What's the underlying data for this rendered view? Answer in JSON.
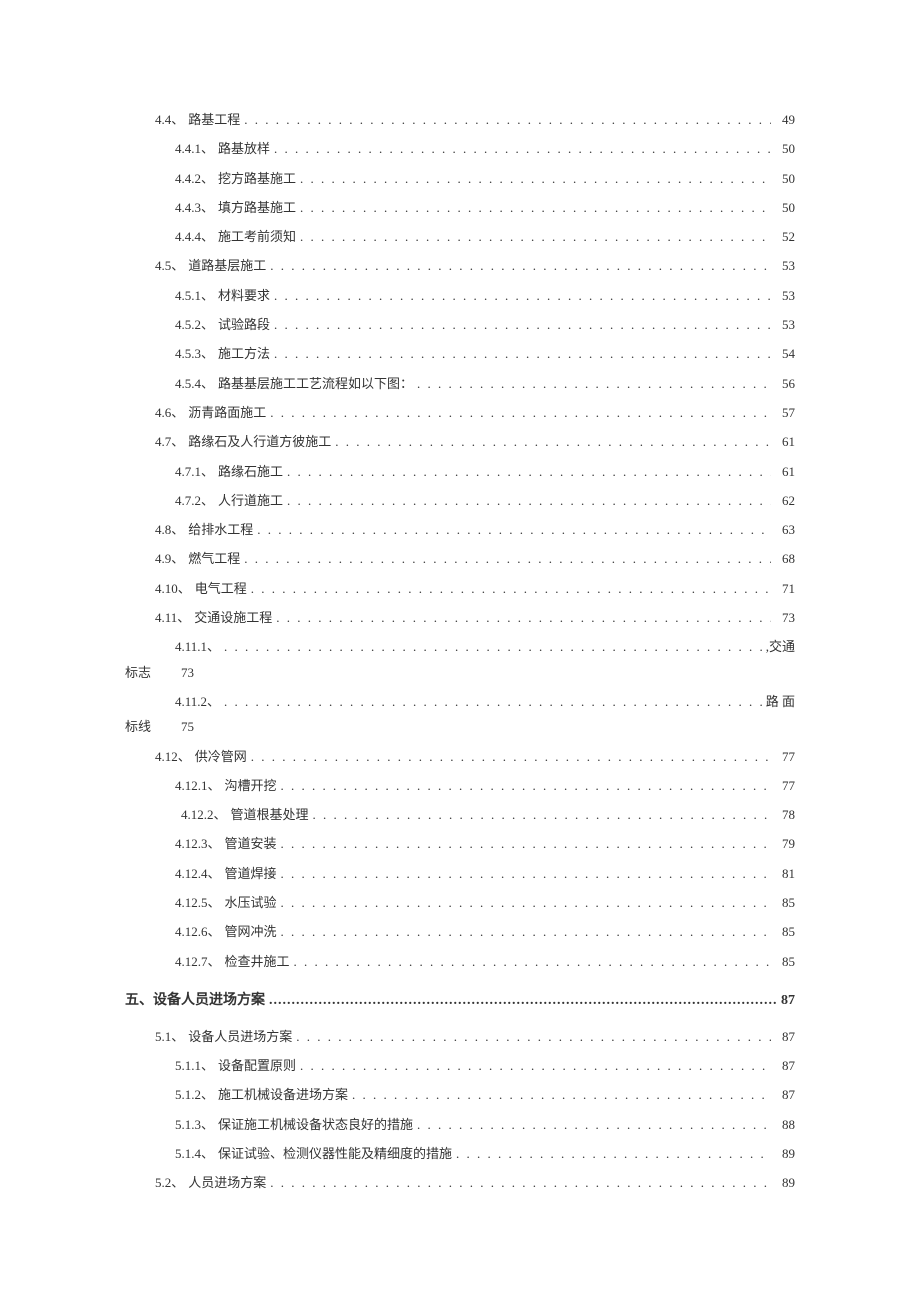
{
  "entries": [
    {
      "lvl": 0,
      "num": "4.4、",
      "title": "路基工程",
      "page": "49"
    },
    {
      "lvl": 1,
      "num": "4.4.1、",
      "title": "路基放样",
      "page": "50"
    },
    {
      "lvl": 1,
      "num": "4.4.2、",
      "title": "挖方路基施工",
      "page": "50"
    },
    {
      "lvl": 1,
      "num": "4.4.3、",
      "title": "填方路基施工",
      "page": "50"
    },
    {
      "lvl": 1,
      "num": "4.4.4、",
      "title": "施工考前须知",
      "page": "52"
    },
    {
      "lvl": 0,
      "num": "4.5、",
      "title": "道路基层施工",
      "page": "53"
    },
    {
      "lvl": 1,
      "num": "4.5.1、",
      "title": "材料要求",
      "page": "53"
    },
    {
      "lvl": 1,
      "num": "4.5.2、",
      "title": "试验路段",
      "page": "53"
    },
    {
      "lvl": 1,
      "num": "4.5.3、",
      "title": "施工方法",
      "page": "54"
    },
    {
      "lvl": 1,
      "num": "4.5.4、",
      "title": "路基基层施工工艺流程如以下图：",
      "page": "56"
    },
    {
      "lvl": 0,
      "num": "4.6、",
      "title": "沥青路面施工 ",
      "page": "57"
    },
    {
      "lvl": 0,
      "num": "4.7、",
      "title": "路缘石及人行道方彼施工",
      "page": "61"
    },
    {
      "lvl": 1,
      "num": "4.7.1、",
      "title": "路缘石施工",
      "page": "61"
    },
    {
      "lvl": 1,
      "num": "4.7.2、",
      "title": "人行道施工",
      "page": "62"
    },
    {
      "lvl": 0,
      "num": "4.8、",
      "title": "给排水工程",
      "page": "63"
    },
    {
      "lvl": 0,
      "num": "4.9、",
      "title": "燃气工程",
      "page": "68"
    },
    {
      "lvl": 0,
      "num": "4.10、",
      "title": "电气工程 ",
      "page": "71"
    },
    {
      "lvl": 0,
      "num": "4.11、",
      "title": "交通设施工程 ",
      "page": "73"
    },
    {
      "lvl": 1,
      "num": "4.11.1、",
      "title": "",
      "trailing": ",交通",
      "wrapTitle": "标志",
      "wrapPage": "73"
    },
    {
      "lvl": 1,
      "num": "4.11.2、",
      "title": "",
      "trailing": "路 面",
      "wrapTitle": "标线",
      "wrapPage": "75"
    },
    {
      "lvl": 0,
      "num": "4.12、",
      "title": "供冷管网 ",
      "page": "77"
    },
    {
      "lvl": 1,
      "num": "4.12.1、",
      "title": "沟槽开挖",
      "page": "77"
    },
    {
      "lvl": 1,
      "num": "4.12.2、",
      "title": "管道根基处理",
      "page": "78",
      "indentSpecial": true,
      "pageRight": true
    },
    {
      "lvl": 1,
      "num": "4.12.3、",
      "title": "管道安装",
      "page": "79"
    },
    {
      "lvl": 1,
      "num": "4.12.4、",
      "title": "管道焊接",
      "page": "81"
    },
    {
      "lvl": 1,
      "num": "4.12.5、",
      "title": "水压试验",
      "page": "85"
    },
    {
      "lvl": 1,
      "num": "4.12.6、",
      "title": "管网冲洗",
      "page": "85"
    },
    {
      "lvl": 1,
      "num": "4.12.7、",
      "title": "检查井施工",
      "page": "85"
    }
  ],
  "heading5": {
    "title": "五、设备人员进场方案 ",
    "page": "87"
  },
  "entries5": [
    {
      "lvl": 0,
      "num": "5.1、",
      "title": "设备人员进场方案",
      "page": "87"
    },
    {
      "lvl": 1,
      "num": "5.1.1、",
      "title": "设备配置原则",
      "page": "87"
    },
    {
      "lvl": 1,
      "num": "5.1.2、",
      "title": "施工机械设备进场方案",
      "page": "87"
    },
    {
      "lvl": 1,
      "num": "5.1.3、",
      "title": "保证施工机械设备状态良好的措施",
      "page": "88"
    },
    {
      "lvl": 1,
      "num": "5.1.4、",
      "title": "保证试验、检测仪器性能及精细度的措施",
      "page": "89"
    },
    {
      "lvl": 0,
      "num": "5.2、",
      "title": "人员进场方案",
      "page": "89"
    }
  ]
}
